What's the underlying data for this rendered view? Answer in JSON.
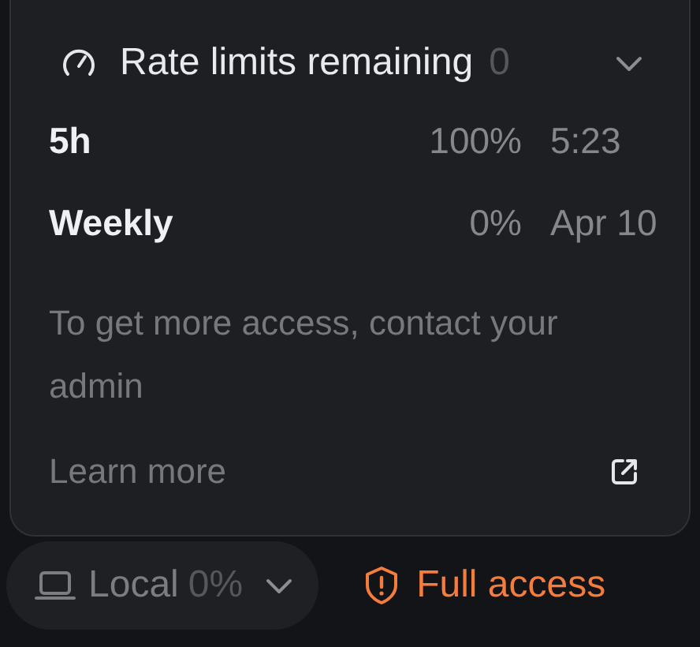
{
  "popup": {
    "title": "Rate limits remaining",
    "title_value": "0",
    "limits": [
      {
        "label": "5h",
        "percent": "100%",
        "reset": "5:23"
      },
      {
        "label": "Weekly",
        "percent": "0%",
        "reset": "Apr 10"
      }
    ],
    "message": "To get more access, contact your admin",
    "link": "Learn more"
  },
  "footer": {
    "environment": {
      "label": "Local",
      "value": "0%"
    },
    "access": "Full access"
  }
}
